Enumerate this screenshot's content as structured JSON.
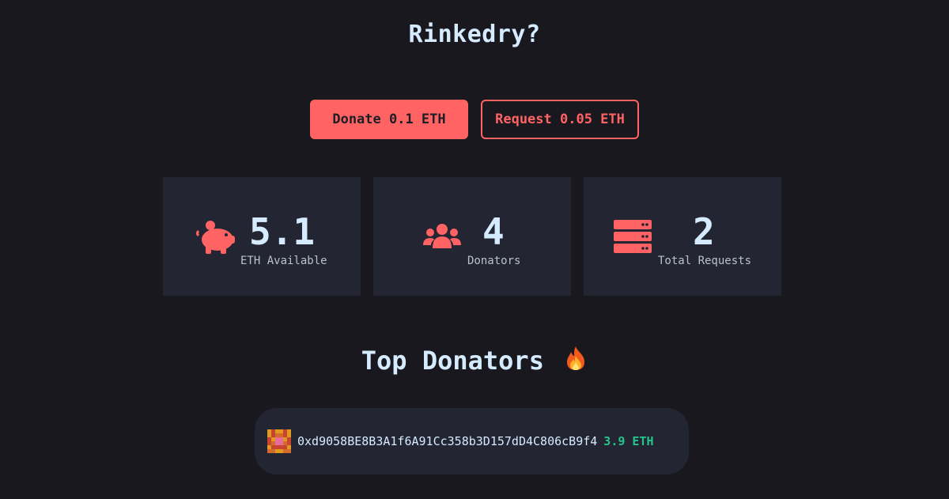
{
  "header": {
    "title": "Rinkedry?"
  },
  "actions": {
    "donate_label": "Donate 0.1 ETH",
    "request_label": "Request 0.05 ETH"
  },
  "stats": [
    {
      "icon": "piggy-bank-icon",
      "value": "5.1",
      "label": "ETH Available"
    },
    {
      "icon": "users-icon",
      "value": "4",
      "label": "Donators"
    },
    {
      "icon": "server-icon",
      "value": "2",
      "label": "Total Requests"
    }
  ],
  "top_donators": {
    "title": "Top Donators",
    "emoji": "fire-icon",
    "items": [
      {
        "avatar": "pixel-avatar",
        "address": "0xd9058BE8B3A1f6A91Cc358b3D157dD4C806cB9f4",
        "amount": "3.9 ETH"
      }
    ]
  },
  "colors": {
    "background": "#18181e",
    "card": "#232532",
    "accent": "#ff6363",
    "text": "#d5ebff",
    "muted": "#b8c2cc",
    "positive": "#22c58b"
  }
}
